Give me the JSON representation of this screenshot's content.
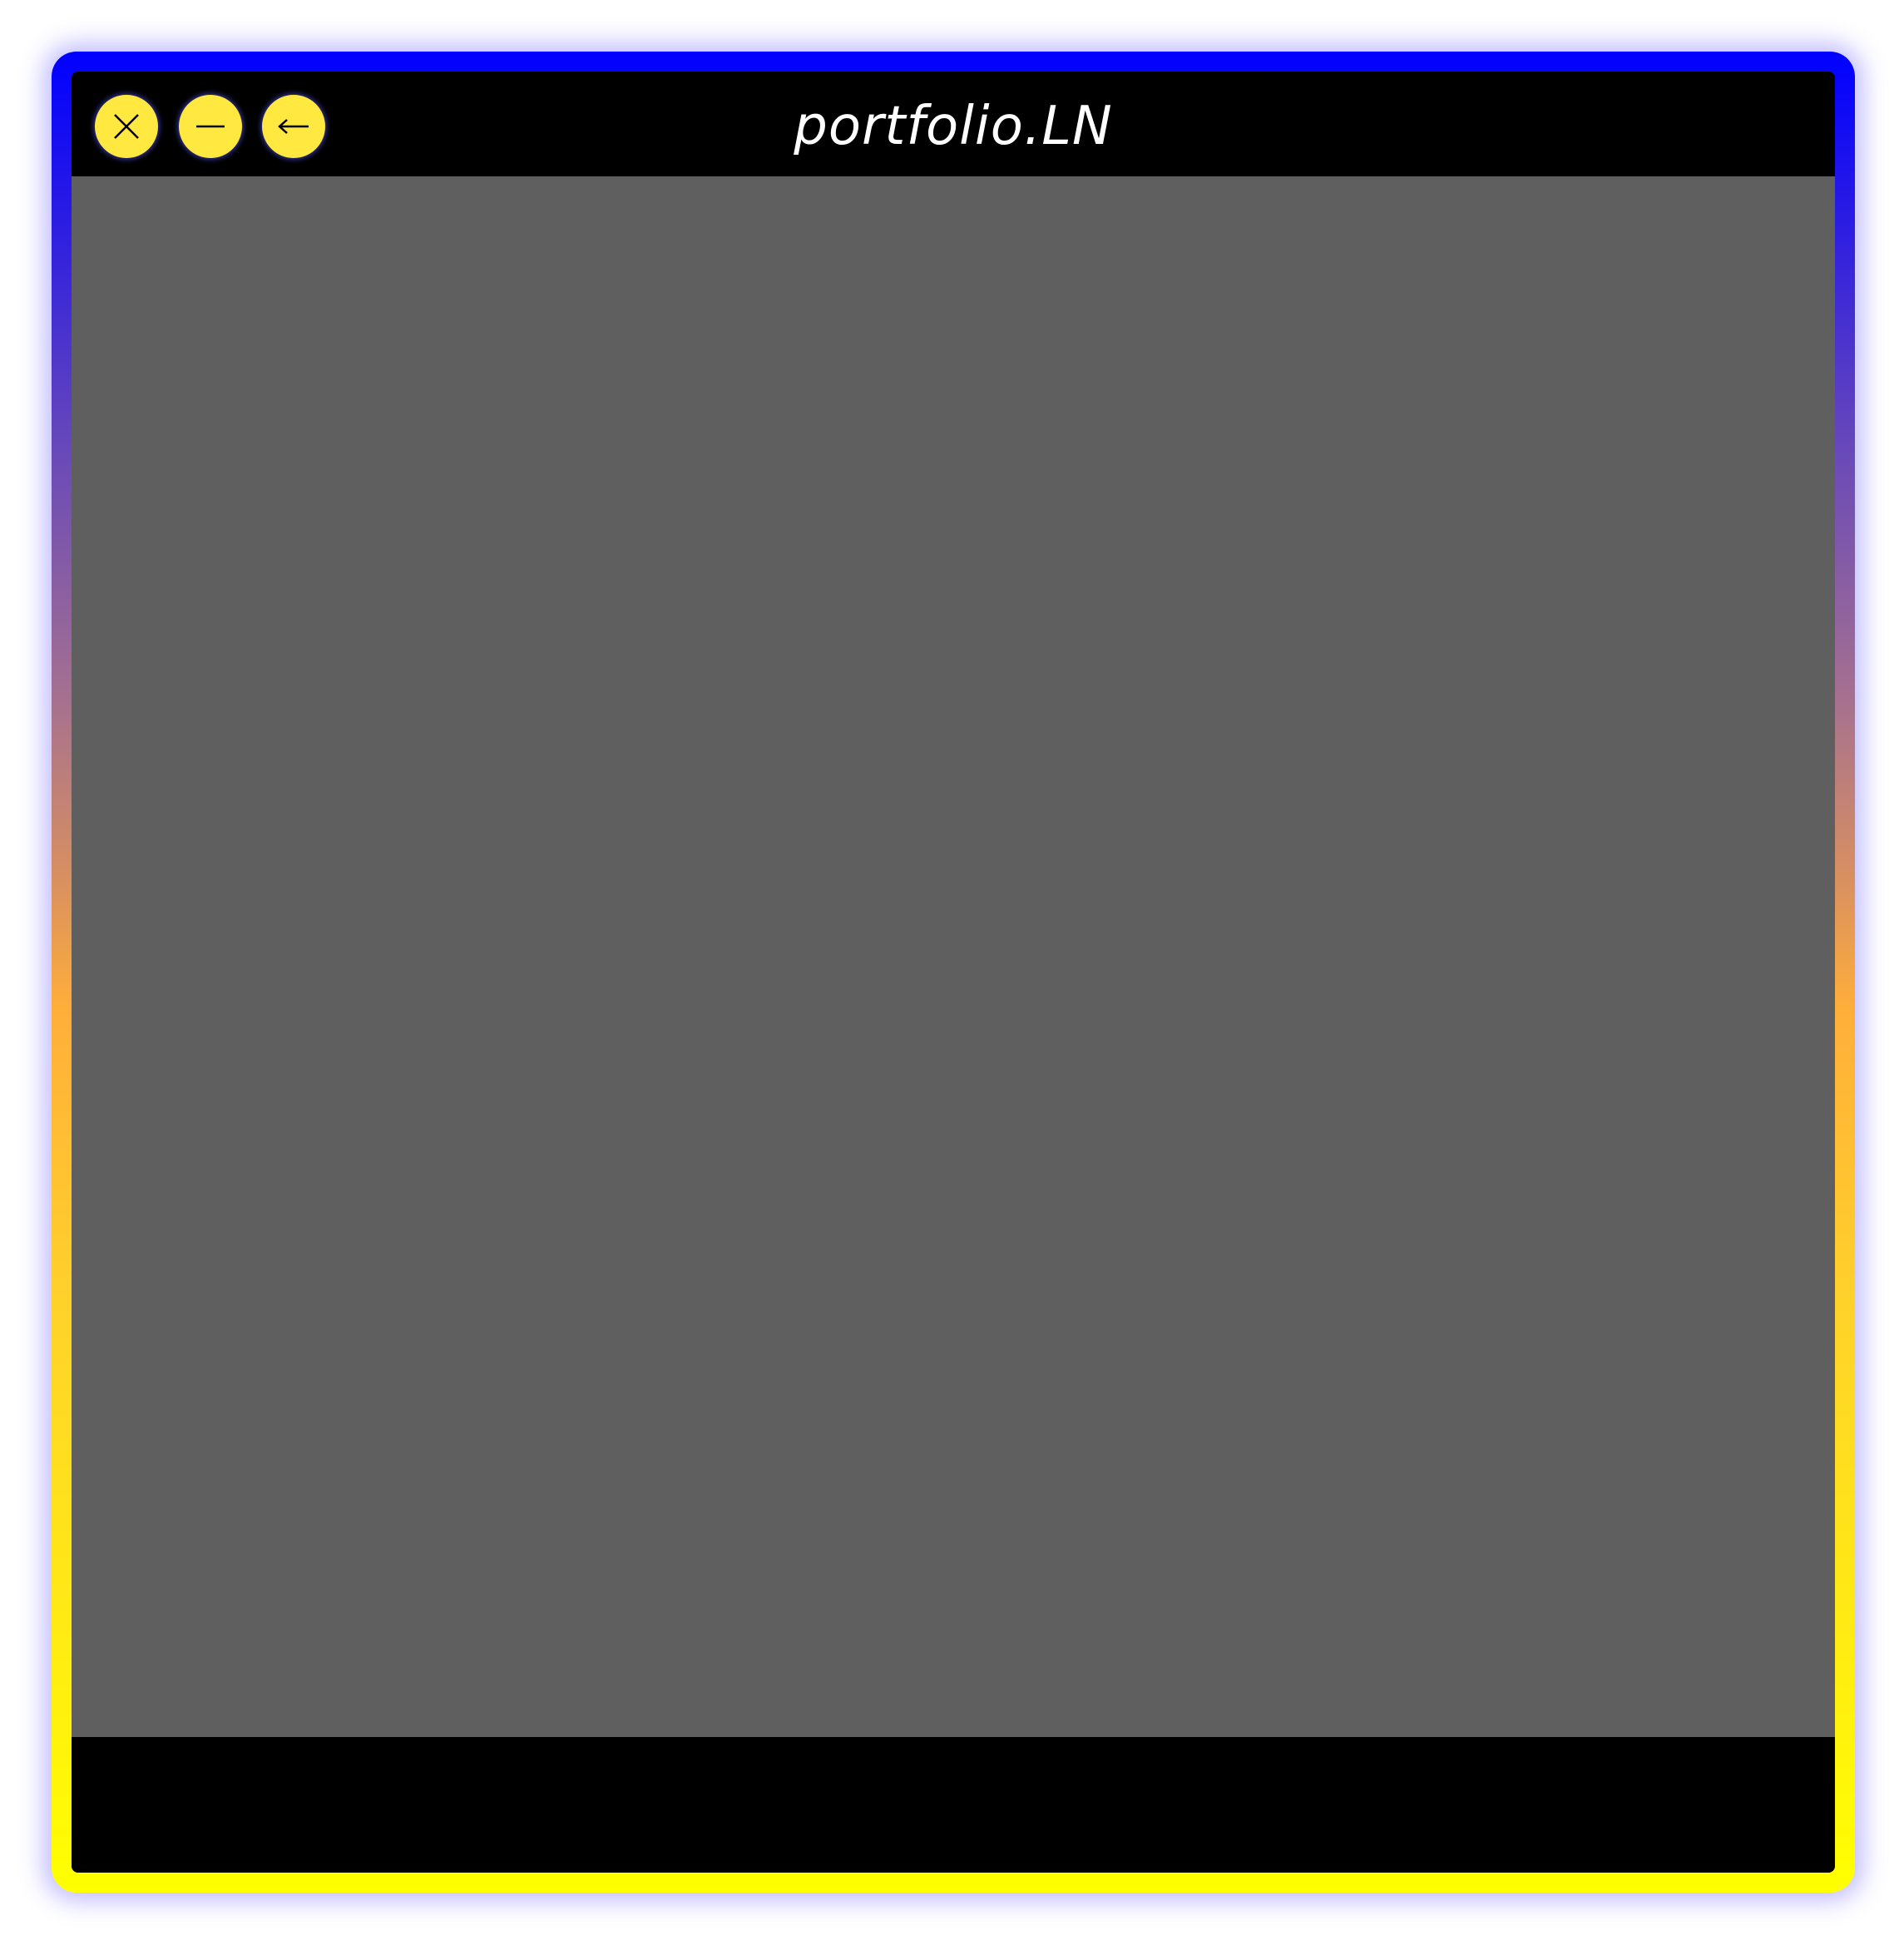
{
  "window": {
    "title": "portfolio.LN",
    "buttons": [
      {
        "name": "close",
        "icon": "close-icon"
      },
      {
        "name": "minimize",
        "icon": "minus-icon"
      },
      {
        "name": "back",
        "icon": "arrow-left-icon"
      }
    ]
  },
  "colors": {
    "border_gradient": [
      "#0000ff",
      "#ffae3a",
      "#ffff00"
    ],
    "button_fill": "#ffe83f",
    "title_bar": "#000000",
    "content": "#5f5f5f",
    "footer": "#000000",
    "title_text": "#ffffff"
  }
}
